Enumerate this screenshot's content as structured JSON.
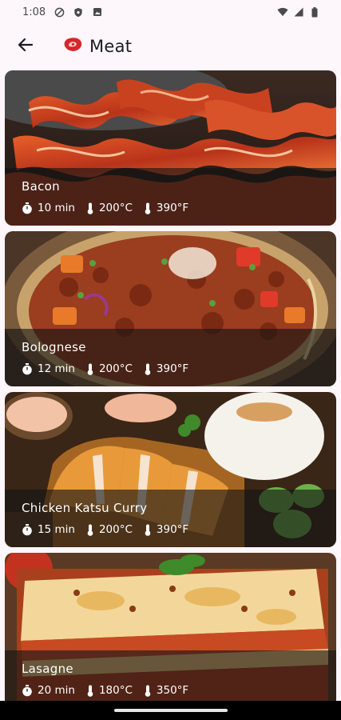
{
  "status_bar": {
    "time": "1:08"
  },
  "app_bar": {
    "title": "Meat",
    "title_icon": "steak-icon",
    "back_icon": "arrow-back-icon"
  },
  "recipes": [
    {
      "name": "Bacon",
      "time": "10 min",
      "temp_c": "200°C",
      "temp_f": "390°F"
    },
    {
      "name": "Bolognese",
      "time": "12 min",
      "temp_c": "200°C",
      "temp_f": "390°F"
    },
    {
      "name": "Chicken Katsu Curry",
      "time": "15 min",
      "temp_c": "200°C",
      "temp_f": "390°F"
    },
    {
      "name": "Lasagne",
      "time": "20 min",
      "temp_c": "180°C",
      "temp_f": "350°F"
    }
  ],
  "icons": {
    "timer": "timer-icon",
    "thermometer": "thermometer-icon"
  },
  "colors": {
    "background": "#fdf7fb",
    "overlay": "#141414",
    "accent_red": "#d8242b"
  }
}
